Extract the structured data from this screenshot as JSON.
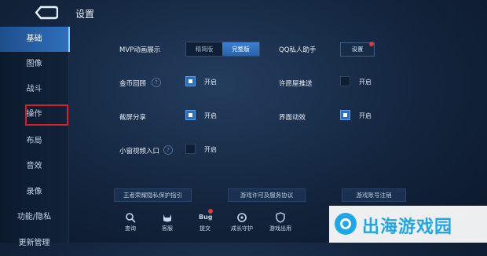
{
  "header": {
    "title": "设置"
  },
  "sidebar": {
    "items": [
      {
        "label": "基础"
      },
      {
        "label": "图像"
      },
      {
        "label": "战斗"
      },
      {
        "label": "操作"
      },
      {
        "label": "布局"
      },
      {
        "label": "音效"
      },
      {
        "label": "录像"
      },
      {
        "label": "功能/隐私"
      },
      {
        "label": "更新管理"
      }
    ],
    "active": "基础",
    "highlighted": "操作"
  },
  "settings": {
    "mvp": {
      "label": "MVP动画展示",
      "options": [
        "精简版",
        "完整版"
      ],
      "selected": "完整版"
    },
    "qq": {
      "label": "QQ私人助手",
      "button": "设置"
    },
    "coins": {
      "label": "金币回顾",
      "toggle_text": "开启",
      "checked": true
    },
    "permission": {
      "label": "许愿屋推送",
      "toggle_text": "开启",
      "checked": false
    },
    "screenshot": {
      "label": "截屏分享",
      "toggle_text": "开启",
      "checked": true
    },
    "ui_anim": {
      "label": "界面动效",
      "toggle_text": "开启",
      "checked": true
    },
    "video": {
      "label": "小窗视频入口",
      "toggle_text": "开启",
      "checked": false
    }
  },
  "links": [
    "王者荣耀隐私保护指引",
    "游戏许可及服务协议",
    "游戏账号注销"
  ],
  "bottom": [
    {
      "icon": "search-icon",
      "label": "查询"
    },
    {
      "icon": "cat-icon",
      "label": "客服"
    },
    {
      "icon": "bug-icon",
      "label": "提交",
      "icon_text": "Bug"
    },
    {
      "icon": "growth-icon",
      "label": "成长守护"
    },
    {
      "icon": "shield-icon",
      "label": "游戏出用"
    }
  ],
  "watermark": {
    "text": "出海游戏园"
  },
  "colors": {
    "accent": "#2f6fc0",
    "highlight_box": "#d81f26",
    "watermark": "#1ea7e8"
  }
}
